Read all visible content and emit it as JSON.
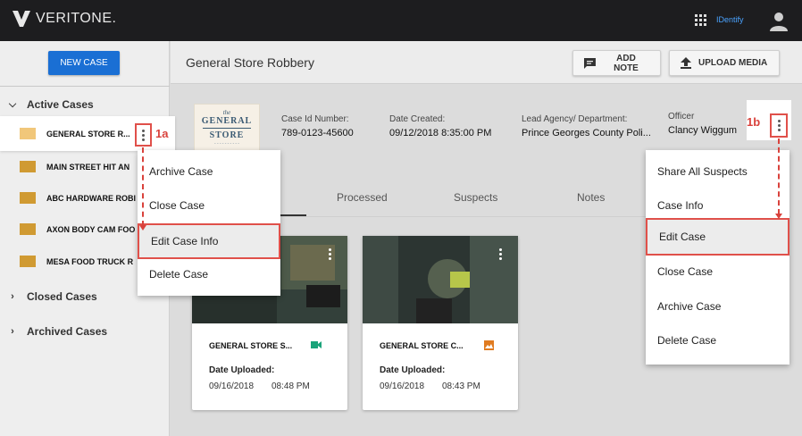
{
  "app": {
    "brand": "VERITONE.",
    "app_name": "IDentify"
  },
  "sidebar": {
    "new_case_label": "NEW CASE",
    "active_cases_label": "Active Cases",
    "closed_cases_label": "Closed Cases",
    "archived_cases_label": "Archived Cases",
    "cases": [
      {
        "label": "GENERAL STORE R..."
      },
      {
        "label": "MAIN STREET HIT AN"
      },
      {
        "label": "ABC HARDWARE ROBI"
      },
      {
        "label": "AXON BODY CAM FOO"
      },
      {
        "label": "MESA FOOD TRUCK R"
      }
    ]
  },
  "header": {
    "title": "General Store Robbery",
    "add_note_label": "ADD NOTE",
    "upload_media_label": "UPLOAD MEDIA"
  },
  "case_info": {
    "logo_the": "the",
    "logo_line1": "GENERAL",
    "logo_line2": "STORE",
    "case_id_label": "Case Id Number:",
    "case_id_value": "789-0123-45600",
    "date_created_label": "Date Created:",
    "date_created_value": "09/12/2018 8:35:00 PM",
    "agency_label": "Lead Agency/ Department:",
    "agency_value": "Prince Georges County Poli...",
    "officer_label": "Officer",
    "officer_value": "Clancy Wiggum"
  },
  "tabs": [
    {
      "label": "Processed"
    },
    {
      "label": "Suspects"
    },
    {
      "label": "Notes"
    }
  ],
  "media": [
    {
      "title": "GENERAL STORE S...",
      "date_label": "Date Uploaded:",
      "date": "09/16/2018",
      "time": "08:48 PM",
      "type": "video-icon",
      "color": "#1aa37a"
    },
    {
      "title": "GENERAL STORE C...",
      "date_label": "Date Uploaded:",
      "date": "09/16/2018",
      "time": "08:43 PM",
      "type": "image-icon",
      "color": "#e07b20"
    }
  ],
  "menu_left": {
    "items": [
      {
        "label": "Archive Case"
      },
      {
        "label": "Close Case"
      },
      {
        "label": "Edit Case Info"
      },
      {
        "label": "Delete Case"
      }
    ]
  },
  "menu_right": {
    "items": [
      {
        "label": "Share All Suspects"
      },
      {
        "label": "Case Info"
      },
      {
        "label": "Edit Case"
      },
      {
        "label": "Close Case"
      },
      {
        "label": "Archive Case"
      },
      {
        "label": "Delete Case"
      }
    ]
  },
  "callouts": {
    "left": "1a",
    "right": "1b"
  },
  "colors": {
    "accent": "#1a6fd4",
    "callout": "#d9423c"
  }
}
